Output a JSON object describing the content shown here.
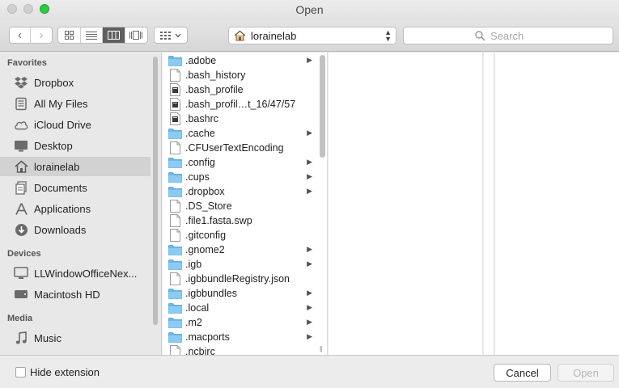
{
  "window": {
    "title": "Open"
  },
  "toolbar": {
    "back_glyph": "‹",
    "forward_glyph": "›",
    "path_label": "lorainelab",
    "search_placeholder": "Search"
  },
  "sidebar": {
    "sections": [
      {
        "title": "Favorites",
        "items": [
          {
            "label": "Dropbox",
            "icon": "dropbox-icon",
            "selected": false
          },
          {
            "label": "All My Files",
            "icon": "all-files-icon",
            "selected": false
          },
          {
            "label": "iCloud Drive",
            "icon": "cloud-icon",
            "selected": false
          },
          {
            "label": "Desktop",
            "icon": "desktop-icon",
            "selected": false
          },
          {
            "label": "lorainelab",
            "icon": "home-icon",
            "selected": true
          },
          {
            "label": "Documents",
            "icon": "documents-icon",
            "selected": false
          },
          {
            "label": "Applications",
            "icon": "applications-icon",
            "selected": false
          },
          {
            "label": "Downloads",
            "icon": "downloads-icon",
            "selected": false
          }
        ]
      },
      {
        "title": "Devices",
        "items": [
          {
            "label": "LLWindowOfficeNex...",
            "icon": "computer-icon",
            "selected": false
          },
          {
            "label": "Macintosh HD",
            "icon": "harddrive-icon",
            "selected": false
          }
        ]
      },
      {
        "title": "Media",
        "items": [
          {
            "label": "Music",
            "icon": "music-icon",
            "selected": false
          }
        ]
      }
    ]
  },
  "files": [
    {
      "name": ".adobe",
      "type": "folder"
    },
    {
      "name": ".bash_history",
      "type": "file"
    },
    {
      "name": ".bash_profile",
      "type": "exec"
    },
    {
      "name": ".bash_profil…t_16/47/57",
      "type": "exec"
    },
    {
      "name": ".bashrc",
      "type": "exec"
    },
    {
      "name": ".cache",
      "type": "folder"
    },
    {
      "name": ".CFUserTextEncoding",
      "type": "file"
    },
    {
      "name": ".config",
      "type": "folder"
    },
    {
      "name": ".cups",
      "type": "folder"
    },
    {
      "name": ".dropbox",
      "type": "folder"
    },
    {
      "name": ".DS_Store",
      "type": "file"
    },
    {
      "name": ".file1.fasta.swp",
      "type": "file"
    },
    {
      "name": ".gitconfig",
      "type": "file"
    },
    {
      "name": ".gnome2",
      "type": "folder"
    },
    {
      "name": ".igb",
      "type": "folder"
    },
    {
      "name": ".igbbundleRegistry.json",
      "type": "file"
    },
    {
      "name": ".igbbundles",
      "type": "folder"
    },
    {
      "name": ".local",
      "type": "folder"
    },
    {
      "name": ".m2",
      "type": "folder"
    },
    {
      "name": ".macports",
      "type": "folder"
    },
    {
      "name": ".ncbirc",
      "type": "file"
    }
  ],
  "footer": {
    "hide_extension_label": "Hide extension",
    "cancel_label": "Cancel",
    "open_label": "Open"
  },
  "colors": {
    "folder": "#6cb8ea",
    "selection": "#d2d2d2",
    "maximize": "#2fc843"
  }
}
